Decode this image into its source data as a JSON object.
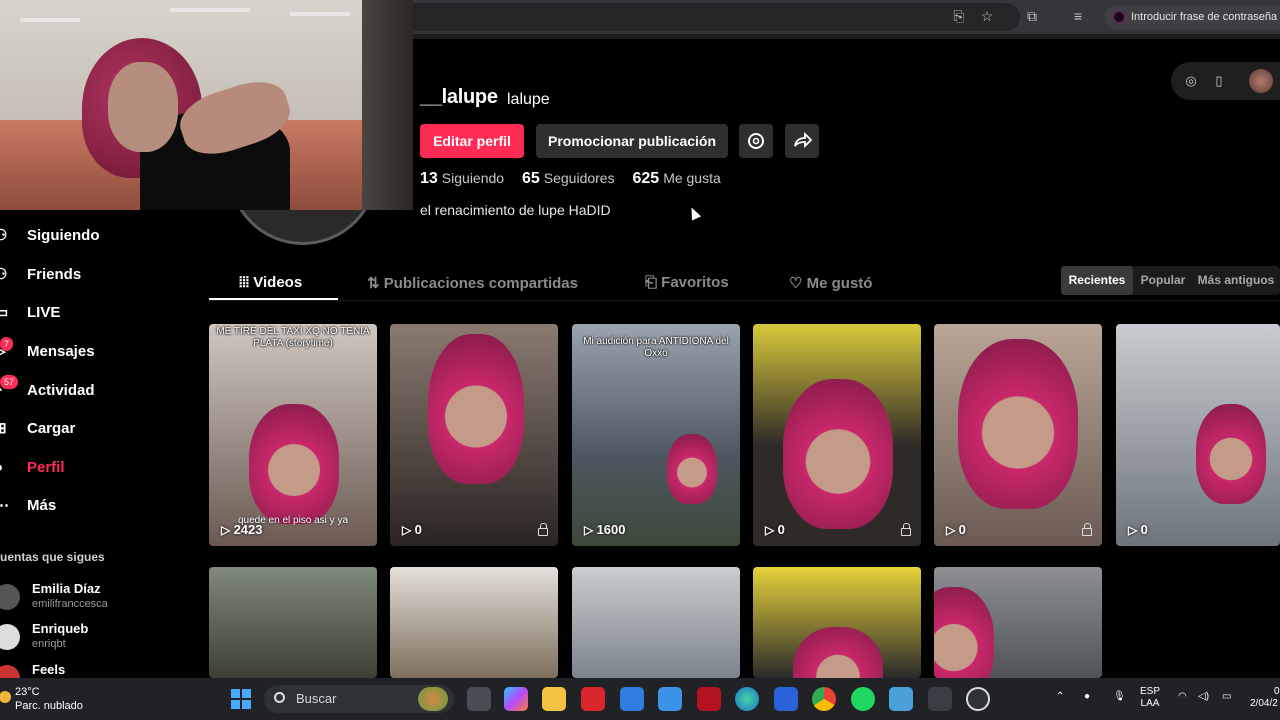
{
  "browser": {
    "password_chip": "Introducir frase de contraseña",
    "icons": [
      "install-icon",
      "star-icon",
      "extensions-icon",
      "media-icon"
    ]
  },
  "profile": {
    "username": "__lalupe",
    "nickname": "lalupe",
    "edit_label": "Editar perfil",
    "promote_label": "Promocionar publicación",
    "stats": {
      "following_count": "13",
      "following_label": "Siguiendo",
      "followers_count": "65",
      "followers_label": "Seguidores",
      "likes_count": "625",
      "likes_label": "Me gusta"
    },
    "bio": "el renacimiento de lupe HaDID"
  },
  "sidebar": {
    "items": [
      {
        "label": "Siguiendo",
        "icon": "following-icon"
      },
      {
        "label": "Friends",
        "icon": "friends-icon"
      },
      {
        "label": "LIVE",
        "icon": "live-icon"
      },
      {
        "label": "Mensajes",
        "icon": "messages-icon",
        "badge": "7"
      },
      {
        "label": "Actividad",
        "icon": "activity-icon",
        "badge": "57"
      },
      {
        "label": "Cargar",
        "icon": "upload-icon"
      },
      {
        "label": "Perfil",
        "icon": "profile-icon",
        "active": true
      },
      {
        "label": "Más",
        "icon": "more-icon"
      }
    ],
    "following_title": "uentas que sigues",
    "accounts": [
      {
        "name": "Emilia Díaz",
        "handle": "emilifranccesca"
      },
      {
        "name": "Enriqueb",
        "handle": "enriqbt"
      },
      {
        "name": "Feels",
        "handle": ""
      }
    ]
  },
  "tabs": [
    {
      "label": "Videos",
      "active": true
    },
    {
      "label": "Publicaciones compartidas"
    },
    {
      "label": "Favoritos"
    },
    {
      "label": "Me gustó"
    }
  ],
  "sort": [
    "Recientes",
    "Popular",
    "Más antiguos"
  ],
  "videos": [
    {
      "caption": "ME TIRE DEL TAXI XQ NO TENIA PLATA (storytime)",
      "subtitle": "quede en el piso asi y ya",
      "views": "2423"
    },
    {
      "caption": "",
      "subtitle": "",
      "views": "0"
    },
    {
      "caption": "Mi audición para ANTIDIONA del Oxxo",
      "subtitle": "",
      "views": "1600"
    },
    {
      "caption": "",
      "subtitle": "",
      "views": "0"
    },
    {
      "caption": "",
      "subtitle": "",
      "views": "0"
    },
    {
      "caption": "",
      "subtitle": "",
      "views": "0"
    }
  ],
  "taskbar": {
    "temp": "23°C",
    "weather": "Parc. nublado",
    "search": "Buscar",
    "lang1": "ESP",
    "lang2": "LAA",
    "time": "0",
    "date": "2/04/2"
  },
  "colors": {
    "accent": "#fe2c55",
    "background": "#000000"
  }
}
